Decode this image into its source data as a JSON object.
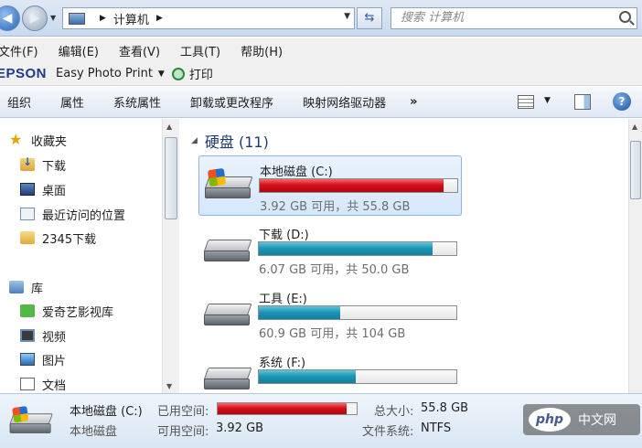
{
  "address": {
    "location": "计算机",
    "search_placeholder": "搜索 计算机"
  },
  "menu": [
    "文件(F)",
    "编辑(E)",
    "查看(V)",
    "工具(T)",
    "帮助(H)"
  ],
  "epson": {
    "logo": "EPSON",
    "program": "Easy Photo Print",
    "print": "打印"
  },
  "toolbar": {
    "commands": [
      "组织",
      "属性",
      "系统属性",
      "卸载或更改程序",
      "映射网络驱动器"
    ],
    "more": "»"
  },
  "nav": {
    "favorites": "收藏夹",
    "fav_items": [
      "下载",
      "桌面",
      "最近访问的位置",
      "2345下载"
    ],
    "libraries": "库",
    "lib_items": [
      "爱奇艺影视库",
      "视频",
      "图片",
      "文档"
    ]
  },
  "group": {
    "label": "硬盘 (11)"
  },
  "drives": [
    {
      "name": "本地磁盘 (C:)",
      "space": "3.92 GB 可用，共 55.8 GB",
      "used_fraction": 0.93,
      "color": "red"
    },
    {
      "name": "下载 (D:)",
      "space": "6.07 GB 可用，共 50.0 GB",
      "used_fraction": 0.88,
      "color": "teal"
    },
    {
      "name": "工具 (E:)",
      "space": "60.9 GB 可用，共 104 GB",
      "used_fraction": 0.41,
      "color": "teal"
    },
    {
      "name": "系统 (F:)",
      "space": "",
      "used_fraction": 0.49,
      "color": "teal"
    }
  ],
  "details": {
    "name": "本地磁盘 (C:)",
    "type": "本地磁盘",
    "used_label": "已用空间:",
    "used_fraction": 0.93,
    "free_label": "可用空间:",
    "free_value": "3.92 GB",
    "total_label": "总大小:",
    "total_value": "55.8 GB",
    "fs_label": "文件系统:",
    "fs_value": "NTFS"
  },
  "watermark": {
    "logo": "php",
    "site": "中文网"
  }
}
